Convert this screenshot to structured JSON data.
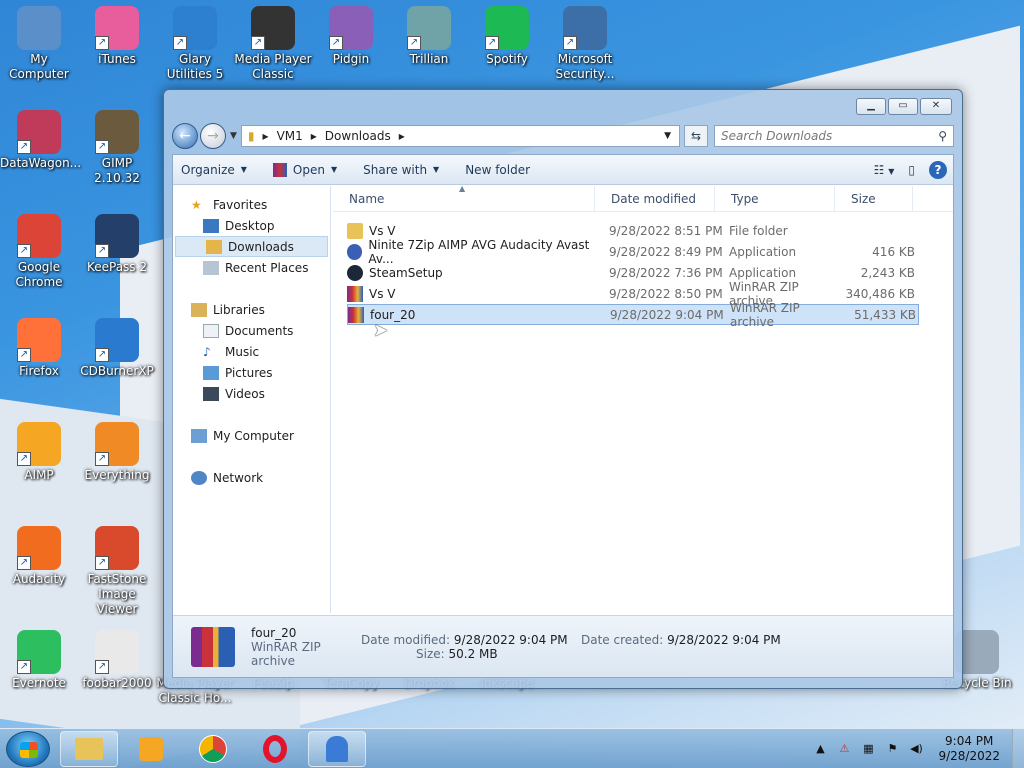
{
  "desktop": {
    "icons": [
      {
        "label": "My Computer",
        "icon": "computer-icon",
        "color": "#5a8fc9"
      },
      {
        "label": "iTunes",
        "icon": "itunes-icon",
        "color": "#e85d9c"
      },
      {
        "label": "Glary Utilities 5",
        "icon": "glary-icon",
        "color": "#2d7fd0"
      },
      {
        "label": "Media Player Classic",
        "icon": "mpc-icon",
        "color": "#333333"
      },
      {
        "label": "Pidgin",
        "icon": "pidgin-icon",
        "color": "#8a5fb8"
      },
      {
        "label": "Trillian",
        "icon": "trillian-icon",
        "color": "#6fa3a8"
      },
      {
        "label": "Spotify",
        "icon": "spotify-icon",
        "color": "#1db954"
      },
      {
        "label": "Microsoft Security...",
        "icon": "security-icon",
        "color": "#3c6ea8"
      },
      {
        "label": "DataWagon...",
        "icon": "datawagon-icon",
        "color": "#c03a5a"
      },
      {
        "label": "GIMP 2.10.32",
        "icon": "gimp-icon",
        "color": "#6b5a3e"
      },
      {
        "label": "Google Chrome",
        "icon": "chrome-icon",
        "color": "#db4437"
      },
      {
        "label": "KeePass 2",
        "icon": "keepass-icon",
        "color": "#24406a"
      },
      {
        "label": "Firefox",
        "icon": "firefox-icon",
        "color": "#ff7139"
      },
      {
        "label": "CDBurnerXP",
        "icon": "cdburner-icon",
        "color": "#2a7ad0"
      },
      {
        "label": "AIMP",
        "icon": "aimp-icon",
        "color": "#f5a623"
      },
      {
        "label": "Everything",
        "icon": "everything-icon",
        "color": "#f08a24"
      },
      {
        "label": "Audacity",
        "icon": "audacity-icon",
        "color": "#f26c1f"
      },
      {
        "label": "FastStone Image Viewer",
        "icon": "faststone-icon",
        "color": "#d9492b"
      },
      {
        "label": "Evernote",
        "icon": "evernote-icon",
        "color": "#2dbe60"
      },
      {
        "label": "foobar2000",
        "icon": "foobar-icon",
        "color": "#e9e9e9"
      },
      {
        "label": "Media Player Classic Ho...",
        "icon": "mpc-hc-icon",
        "color": "#333333"
      },
      {
        "label": "PeaZip",
        "icon": "peazip-icon",
        "color": "#6aa84f"
      },
      {
        "label": "TeraCopy",
        "icon": "teracopy-icon",
        "color": "#3d85c6"
      },
      {
        "label": "Dropbox",
        "icon": "dropbox-icon",
        "color": "#0061fe"
      },
      {
        "label": "Inkscape",
        "icon": "inkscape-icon",
        "color": "#222222"
      },
      {
        "label": "Recycle Bin",
        "icon": "recycle-bin-icon",
        "color": "#9ab"
      }
    ]
  },
  "explorer": {
    "breadcrumb": [
      "VM1",
      "Downloads"
    ],
    "search_placeholder": "Search Downloads",
    "toolbar": {
      "organize": "Organize",
      "open": "Open",
      "share_with": "Share with",
      "new_folder": "New folder"
    },
    "nav": {
      "favorites": "Favorites",
      "desktop": "Desktop",
      "downloads": "Downloads",
      "recent_places": "Recent Places",
      "libraries": "Libraries",
      "documents": "Documents",
      "music": "Music",
      "pictures": "Pictures",
      "videos": "Videos",
      "my_computer": "My Computer",
      "network": "Network"
    },
    "columns": {
      "name": "Name",
      "date": "Date modified",
      "type": "Type",
      "size": "Size"
    },
    "files": [
      {
        "name": "Vs V",
        "date": "9/28/2022 8:51 PM",
        "type": "File folder",
        "size": "",
        "icon": "folder-icon"
      },
      {
        "name": "Ninite 7Zip AIMP AVG Audacity Avast Av...",
        "date": "9/28/2022 8:49 PM",
        "type": "Application",
        "size": "416 KB",
        "icon": "ninite-icon"
      },
      {
        "name": "SteamSetup",
        "date": "9/28/2022 7:36 PM",
        "type": "Application",
        "size": "2,243 KB",
        "icon": "steam-icon"
      },
      {
        "name": "Vs V",
        "date": "9/28/2022 8:50 PM",
        "type": "WinRAR ZIP archive",
        "size": "340,486 KB",
        "icon": "winrar-icon"
      },
      {
        "name": "four_20",
        "date": "9/28/2022 9:04 PM",
        "type": "WinRAR ZIP archive",
        "size": "51,433 KB",
        "icon": "winrar-icon",
        "selected": true
      }
    ],
    "details": {
      "name": "four_20",
      "type": "WinRAR ZIP archive",
      "date_modified_label": "Date modified:",
      "date_modified": "9/28/2022 9:04 PM",
      "date_created_label": "Date created:",
      "date_created": "9/28/2022 9:04 PM",
      "size_label": "Size:",
      "size": "50.2 MB"
    }
  },
  "taskbar": {
    "time": "9:04 PM",
    "date": "9/28/2022"
  }
}
